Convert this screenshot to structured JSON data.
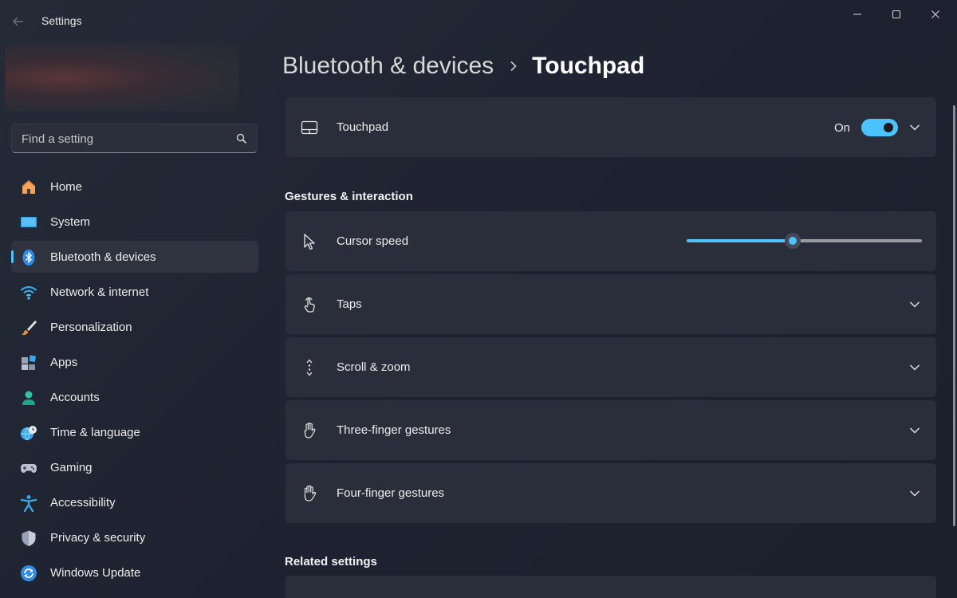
{
  "window": {
    "title": "Settings"
  },
  "search": {
    "placeholder": "Find a setting"
  },
  "sidebar": {
    "items": [
      {
        "label": "Home",
        "icon": "home-icon",
        "selected": false
      },
      {
        "label": "System",
        "icon": "system-icon",
        "selected": false
      },
      {
        "label": "Bluetooth & devices",
        "icon": "bluetooth-icon",
        "selected": true
      },
      {
        "label": "Network & internet",
        "icon": "wifi-icon",
        "selected": false
      },
      {
        "label": "Personalization",
        "icon": "brush-icon",
        "selected": false
      },
      {
        "label": "Apps",
        "icon": "apps-icon",
        "selected": false
      },
      {
        "label": "Accounts",
        "icon": "account-icon",
        "selected": false
      },
      {
        "label": "Time & language",
        "icon": "globe-clock-icon",
        "selected": false
      },
      {
        "label": "Gaming",
        "icon": "gamepad-icon",
        "selected": false
      },
      {
        "label": "Accessibility",
        "icon": "accessibility-icon",
        "selected": false
      },
      {
        "label": "Privacy & security",
        "icon": "shield-icon",
        "selected": false
      },
      {
        "label": "Windows Update",
        "icon": "update-icon",
        "selected": false
      }
    ]
  },
  "breadcrumb": {
    "parent": "Bluetooth & devices",
    "current": "Touchpad"
  },
  "touchpad": {
    "label": "Touchpad",
    "state_text": "On",
    "enabled": true
  },
  "gestures": {
    "section_title": "Gestures & interaction",
    "cursor_speed": {
      "label": "Cursor speed",
      "value": 0.45
    },
    "taps": {
      "label": "Taps"
    },
    "scroll_zoom": {
      "label": "Scroll & zoom"
    },
    "three_finger": {
      "label": "Three-finger gestures"
    },
    "four_finger": {
      "label": "Four-finger gestures"
    }
  },
  "related": {
    "section_title": "Related settings"
  },
  "colors": {
    "accent": "#4cc2ff",
    "card": "#2a2e3b",
    "background": "#1f2330"
  }
}
